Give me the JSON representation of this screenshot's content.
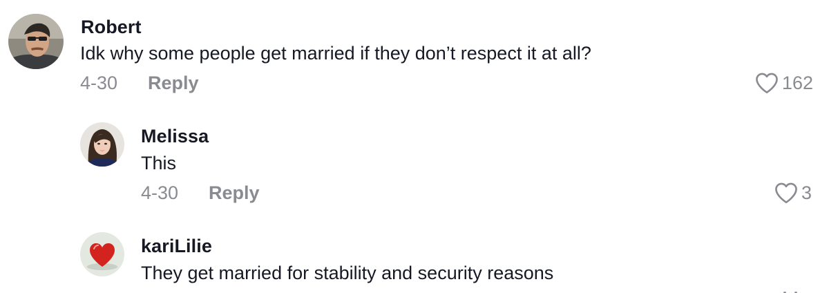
{
  "comments": [
    {
      "username": "Robert",
      "text": "Idk why some people get married if they don’t respect it at all?",
      "date": "4-30",
      "reply_label": "Reply",
      "likes": "162",
      "avatar_icon": "man-portrait"
    },
    {
      "username": "Melissa",
      "text": "This",
      "date": "4-30",
      "reply_label": "Reply",
      "likes": "3",
      "avatar_icon": "woman-portrait"
    },
    {
      "username": "kariLilie",
      "text": "They get married for stability and security reasons",
      "avatar_icon": "red-heart"
    }
  ],
  "icons": {
    "like": "heart-outline-icon"
  },
  "colors": {
    "text_primary": "#161823",
    "text_secondary": "#8a8b91"
  }
}
